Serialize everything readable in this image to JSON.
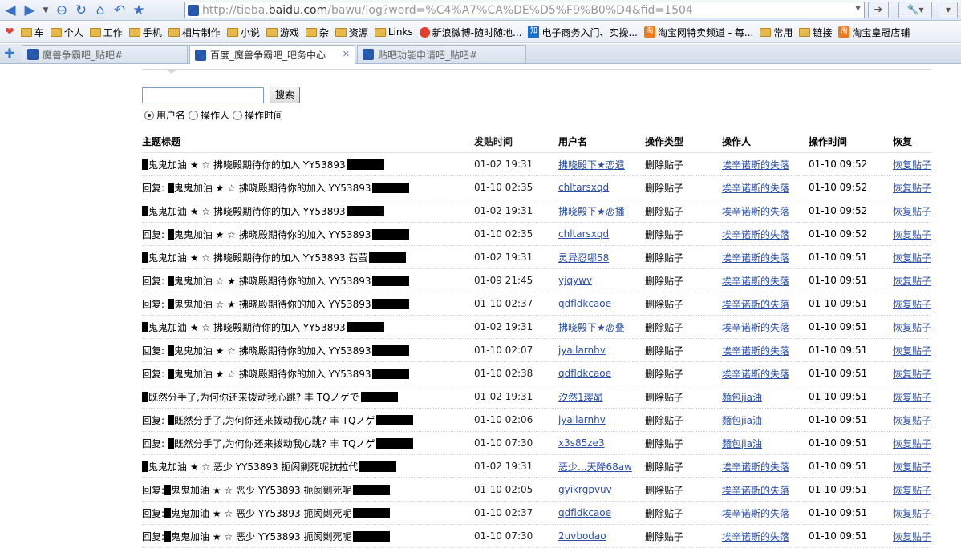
{
  "browser": {
    "url_prefix": "http://tieba.",
    "url_domain": "baidu.com",
    "url_path": "/bawu/log?word=%C4%A7%CA%DE%D5%F9%B0%D4&fid=1504",
    "bookmarks": [
      "车",
      "个人",
      "工作",
      "手机",
      "相片制作",
      "小说",
      "游戏",
      "杂",
      "资源",
      "Links",
      "新浪微博-随时随地...",
      "电子商务入门、实操...",
      "淘宝网特卖频道 - 每...",
      "常用",
      "链接",
      "淘宝皇冠店铺"
    ],
    "tabs": [
      "魔兽争霸吧_贴吧#",
      "百度_魔兽争霸吧_吧务中心",
      "贴吧功能申请吧_贴吧#"
    ]
  },
  "search": {
    "button_label": "搜索",
    "radio_options": [
      "用户名",
      "操作人",
      "操作时间"
    ],
    "selected": "用户名"
  },
  "table": {
    "headers": {
      "title": "主题标题",
      "post_time": "发贴时间",
      "username": "用户名",
      "op_type": "操作类型",
      "operator": "操作人",
      "op_time": "操作时间",
      "restore": "恢复"
    },
    "rows": [
      {
        "pre": "",
        "title": "鬼鬼加油 ★ ☆ 拂晓殿期待你的加入 YY53893",
        "post_time": "01-02 19:31",
        "user": "拂晓殿下★恋遗",
        "type": "删除贴子",
        "op": "埃辛诺斯的失落",
        "op_time": "01-10 09:52",
        "restore": "恢复贴子"
      },
      {
        "pre": "回复: ",
        "title": "鬼鬼加油 ★ ☆ 拂晓殿期待你的加入 YY53893",
        "post_time": "01-10 02:35",
        "user": "chltarsxqd",
        "type": "删除贴子",
        "op": "埃辛诺斯的失落",
        "op_time": "01-10 09:52",
        "restore": "恢复贴子"
      },
      {
        "pre": "",
        "title": "鬼鬼加油 ★ ☆ 拂晓殿期待你的加入 YY53893",
        "post_time": "01-02 19:31",
        "user": "拂晓殿下★恋播",
        "type": "删除贴子",
        "op": "埃辛诺斯的失落",
        "op_time": "01-10 09:52",
        "restore": "恢复贴子"
      },
      {
        "pre": "回复: ",
        "title": "鬼鬼加油 ★ ☆ 拂晓殿期待你的加入 YY53893",
        "post_time": "01-10 02:35",
        "user": "chltarsxqd",
        "type": "删除贴子",
        "op": "埃辛诺斯的失落",
        "op_time": "01-10 09:52",
        "restore": "恢复贴子"
      },
      {
        "pre": "",
        "title": "鬼鬼加油 ★ ☆ 拂晓殿期待你的加入 YY53893 萏萤",
        "post_time": "01-02 19:31",
        "user": "灵异忍哪58",
        "type": "删除贴子",
        "op": "埃辛诺斯的失落",
        "op_time": "01-10 09:51",
        "restore": "恢复贴子"
      },
      {
        "pre": "回复: ",
        "title": "鬼鬼加油 ☆ ★ 拂晓殿期待你的加入 YY53893",
        "post_time": "01-09 21:45",
        "user": "yjqywv",
        "type": "删除贴子",
        "op": "埃辛诺斯的失落",
        "op_time": "01-10 09:51",
        "restore": "恢复贴子"
      },
      {
        "pre": "回复: ",
        "title": "鬼鬼加油 ☆ ★ 拂晓殿期待你的加入 YY53893",
        "post_time": "01-10 02:37",
        "user": "qdfldkcaoe",
        "type": "删除贴子",
        "op": "埃辛诺斯的失落",
        "op_time": "01-10 09:51",
        "restore": "恢复贴子"
      },
      {
        "pre": "",
        "title": "鬼鬼加油 ★ ☆ 拂晓殿期待你的加入 YY53893",
        "post_time": "01-02 19:31",
        "user": "拂晓殿下★恋叠",
        "type": "删除贴子",
        "op": "埃辛诺斯的失落",
        "op_time": "01-10 09:51",
        "restore": "恢复贴子"
      },
      {
        "pre": "回复: ",
        "title": "鬼鬼加油 ★ ☆ 拂晓殿期待你的加入 YY53893",
        "post_time": "01-10 02:07",
        "user": "jyailarnhv",
        "type": "删除贴子",
        "op": "埃辛诺斯的失落",
        "op_time": "01-10 09:51",
        "restore": "恢复贴子"
      },
      {
        "pre": "回复: ",
        "title": "鬼鬼加油 ★ ☆ 拂晓殿期待你的加入 YY53893",
        "post_time": "01-10 02:38",
        "user": "qdfldkcaoe",
        "type": "删除贴子",
        "op": "埃辛诺斯的失落",
        "op_time": "01-10 09:51",
        "restore": "恢复贴子"
      },
      {
        "pre": "",
        "title": "既然分手了,为何你还来拨动我心跳? 丰 TQノゲで",
        "post_time": "01-02 19:31",
        "user": "汐然1璎昴",
        "type": "删除贴子",
        "op": "麵包jia油",
        "op_time": "01-10 09:51",
        "restore": "恢复贴子"
      },
      {
        "pre": "回复: ",
        "title": "既然分手了,为何你还来拨动我心跳? 丰 TQノゲ",
        "post_time": "01-10 02:06",
        "user": "jyailarnhv",
        "type": "删除贴子",
        "op": "麵包jia油",
        "op_time": "01-10 09:51",
        "restore": "恢复贴子"
      },
      {
        "pre": "回复: ",
        "title": "既然分手了,为何你还来拨动我心跳? 丰 TQノゲ",
        "post_time": "01-10 07:30",
        "user": "x3s85ze3",
        "type": "删除贴子",
        "op": "麵包jia油",
        "op_time": "01-10 09:51",
        "restore": "恢复贴子"
      },
      {
        "pre": "",
        "title": "鬼鬼加油 ★ ☆ 恶少 YY53893 扼阂剿死呢抗拉代",
        "post_time": "01-02 19:31",
        "user": "恶少...天降68aw",
        "type": "删除贴子",
        "op": "埃辛诺斯的失落",
        "op_time": "01-10 09:51",
        "restore": "恢复贴子"
      },
      {
        "pre": "回复:",
        "title": "鬼鬼加油 ★ ☆ 恶少 YY53893 扼阂剿死呢",
        "post_time": "01-10 02:05",
        "user": "gyikrgpvuv",
        "type": "删除贴子",
        "op": "埃辛诺斯的失落",
        "op_time": "01-10 09:51",
        "restore": "恢复贴子"
      },
      {
        "pre": "回复:",
        "title": "鬼鬼加油 ★ ☆ 恶少 YY53893 扼阂剿死呢",
        "post_time": "01-10 02:37",
        "user": "qdfldkcaoe",
        "type": "删除贴子",
        "op": "埃辛诺斯的失落",
        "op_time": "01-10 09:51",
        "restore": "恢复贴子"
      },
      {
        "pre": "回复:",
        "title": "鬼鬼加油 ★ ☆ 恶少 YY53893 扼阂剿死呢",
        "post_time": "01-10 07:30",
        "user": "2uvbodao",
        "type": "删除贴子",
        "op": "埃辛诺斯的失落",
        "op_time": "01-10 09:51",
        "restore": "恢复贴子"
      }
    ]
  }
}
